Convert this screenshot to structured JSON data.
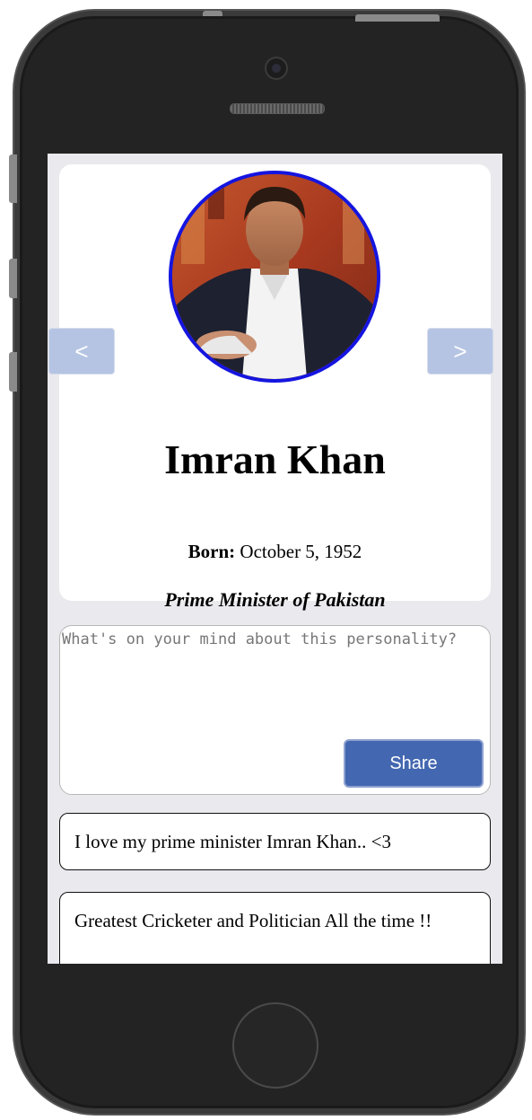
{
  "profile": {
    "name": "Imran Khan",
    "born_label": "Born:",
    "born_value": "October 5, 1952",
    "role": "Prime Minister of Pakistan"
  },
  "navigation": {
    "prev_label": "<",
    "next_label": ">"
  },
  "composer": {
    "placeholder": "What's on your mind about this personality?",
    "value": "",
    "share_label": "Share"
  },
  "comments": [
    {
      "text": "I love my prime minister Imran Khan.. <3"
    },
    {
      "text": "Greatest Cricketer and Politician All the time !!"
    }
  ],
  "colors": {
    "avatar_border": "#1515e0",
    "nav_button": "#b5c4e3",
    "share_button": "#4367b0",
    "screen_background": "#e9e9ee",
    "phone_body": "#232323"
  },
  "icons": {
    "camera": "camera-icon",
    "speaker": "speaker-grille-icon",
    "home": "home-button-icon"
  }
}
